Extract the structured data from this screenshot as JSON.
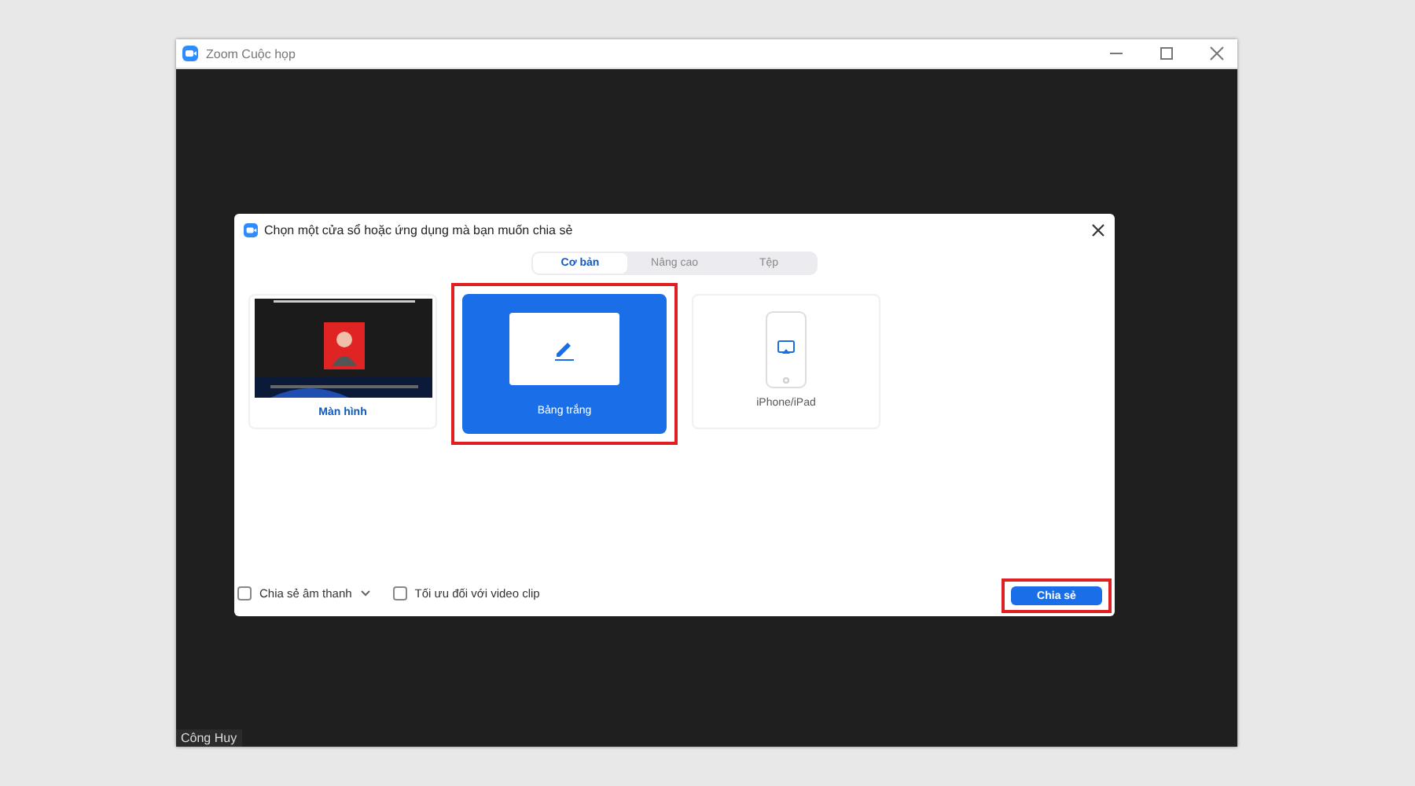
{
  "window": {
    "title": "Zoom Cuộc họp",
    "participant_name": "Công Huy"
  },
  "dialog": {
    "title": "Chọn một cửa sổ hoặc ứng dụng mà bạn muốn chia sẻ",
    "tabs": [
      {
        "label": "Cơ bản",
        "selected": true
      },
      {
        "label": "Nâng cao",
        "selected": false
      },
      {
        "label": "Tệp",
        "selected": false
      }
    ],
    "options": [
      {
        "kind": "screen",
        "label": "Màn hình",
        "selected": false,
        "highlighted": false
      },
      {
        "kind": "whiteboard",
        "label": "Bảng trắng",
        "selected": true,
        "highlighted": true
      },
      {
        "kind": "device",
        "label": "iPhone/iPad",
        "selected": false,
        "highlighted": false
      }
    ],
    "checkboxes": [
      {
        "label": "Chia sẻ âm thanh",
        "checked": false,
        "has_dropdown": true
      },
      {
        "label": "Tối ưu đối với video clip",
        "checked": false,
        "has_dropdown": false
      }
    ],
    "share_button": {
      "label": "Chia sẻ",
      "highlighted": true
    }
  }
}
